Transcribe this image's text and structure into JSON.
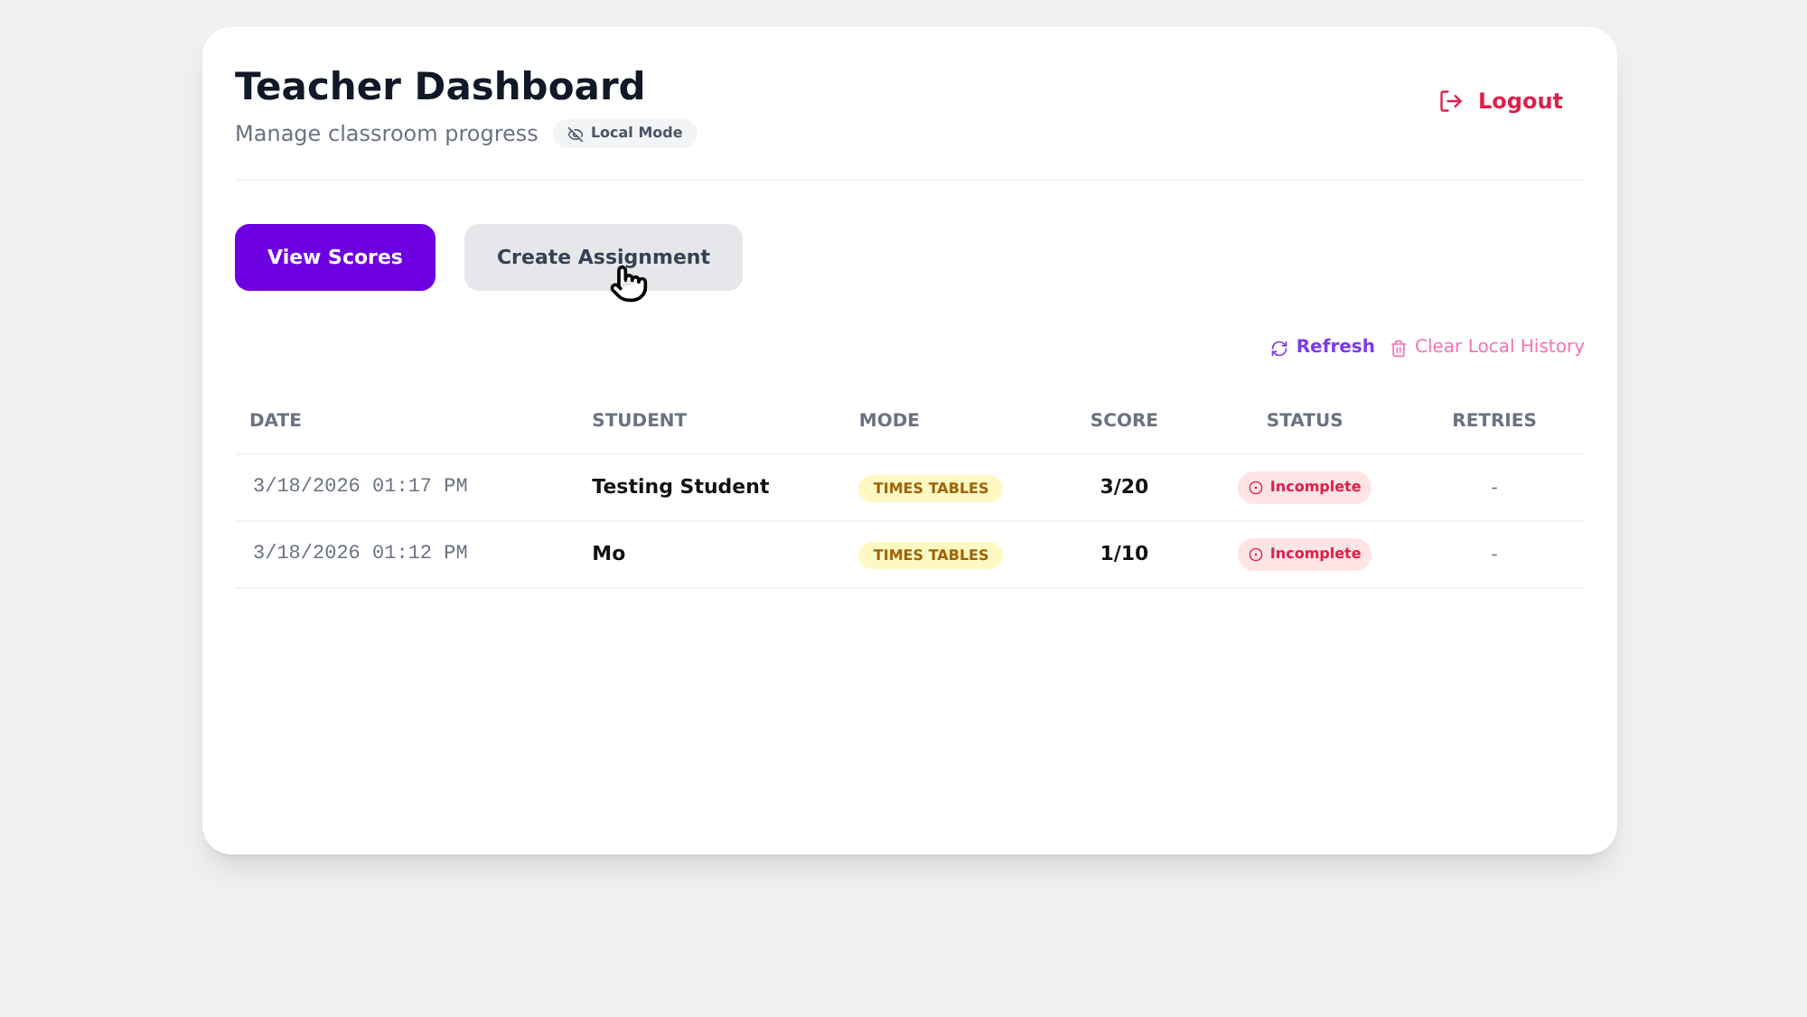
{
  "header": {
    "title": "Teacher Dashboard",
    "subtitle": "Manage classroom progress",
    "badge": "Local Mode",
    "logout": "Logout"
  },
  "tabs": [
    {
      "label": "View Scores",
      "selected": true
    },
    {
      "label": "Create Assignment",
      "selected": false
    }
  ],
  "actions": {
    "refresh": "Refresh",
    "clear": "Clear Local History"
  },
  "table": {
    "columns": [
      "DATE",
      "STUDENT",
      "MODE",
      "SCORE",
      "STATUS",
      "RETRIES"
    ],
    "rows": [
      {
        "date": "3/18/2026 01:17 PM",
        "student": "Testing Student",
        "mode": "TIMES TABLES",
        "score": "3/20",
        "status": "Incomplete",
        "retries": "-"
      },
      {
        "date": "3/18/2026 01:12 PM",
        "student": "Mo",
        "mode": "TIMES TABLES",
        "score": "1/10",
        "status": "Incomplete",
        "retries": "-"
      }
    ]
  }
}
